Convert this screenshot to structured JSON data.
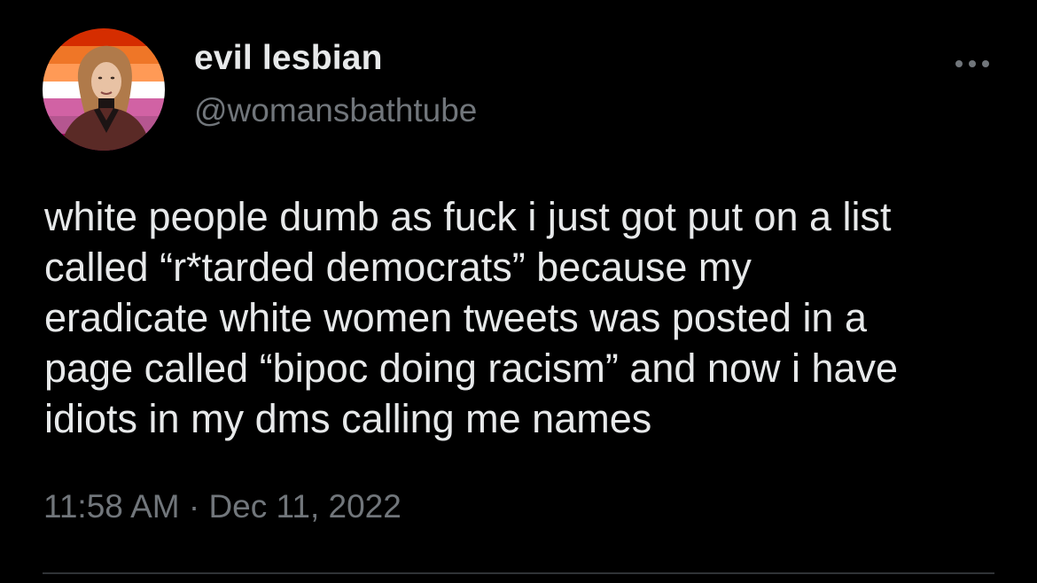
{
  "author": {
    "display_name": "evil lesbian",
    "handle": "@womansbathtube",
    "avatar_icon": "avatar-lesbian-flag-photo",
    "avatar_flag_colors": [
      "#d52d00",
      "#ef7627",
      "#ff9a56",
      "#ffffff",
      "#d162a4",
      "#b55690",
      "#a30262"
    ]
  },
  "tweet": {
    "text_lines": [
      "white people dumb as fuck i just got put on a list",
      "called “r*tarded democrats” because my",
      "eradicate white women tweets was posted in a",
      "page called “bipoc doing racism” and now i have",
      "idiots in my dms calling me names"
    ],
    "timestamp": "11:58 AM · Dec 11, 2022"
  },
  "actions": {
    "more_icon": "more-horizontal-icon"
  },
  "colors": {
    "background": "#000000",
    "primary_text": "#e7e9ea",
    "secondary_text": "#71767b",
    "divider": "#2f3336"
  }
}
